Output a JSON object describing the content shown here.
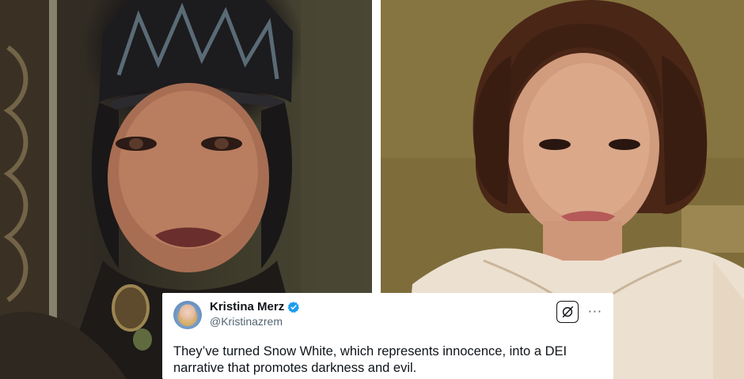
{
  "images": {
    "left": {
      "alt": ""
    },
    "right": {
      "alt": ""
    }
  },
  "tweet": {
    "author": {
      "display_name": "Kristina Merz",
      "handle": "@Kristinazrem",
      "verified": true,
      "verified_icon": "verified-badge-icon",
      "avatar_icon": "avatar"
    },
    "actions": {
      "grok_icon": "grok-icon",
      "more_icon": "more-options-icon",
      "more_glyph": "···"
    },
    "text_line_1": "They’ve turned Snow White, which represents innocence, into a DEI",
    "text_line_2": "narrative that promotes darkness and evil."
  },
  "colors": {
    "verified_blue": "#1d9bf0",
    "text_primary": "#0f1419",
    "text_secondary": "#536471"
  }
}
